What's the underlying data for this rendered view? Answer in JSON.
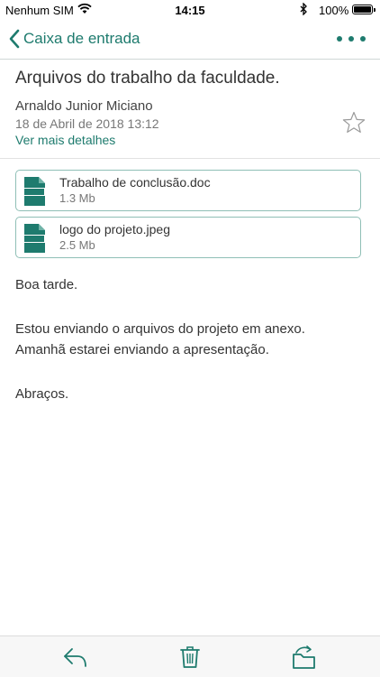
{
  "status_bar": {
    "carrier": "Nenhum SIM",
    "time": "14:15",
    "battery": "100%"
  },
  "nav": {
    "back_label": "Caixa de entrada",
    "accent_color": "#1e7b6e"
  },
  "email": {
    "subject": "Arquivos do trabalho da faculdade.",
    "sender": "Arnaldo Junior Miciano",
    "date": "18 de Abril de 2018 13:12",
    "details_link": "Ver mais detalhes",
    "attachments": [
      {
        "name": "Trabalho de conclusão.doc",
        "size": "1.3 Mb",
        "icon": "document-icon"
      },
      {
        "name": "logo do projeto.jpeg",
        "size": "2.5 Mb",
        "icon": "document-icon"
      }
    ],
    "body": [
      "Boa tarde.",
      "Estou enviando o arquivos do projeto em anexo.",
      "Amanhã estarei enviando a apresentação.",
      "Abraços."
    ]
  },
  "toolbar": {
    "icons": [
      "reply-icon",
      "trash-icon",
      "move-to-folder-icon"
    ]
  }
}
